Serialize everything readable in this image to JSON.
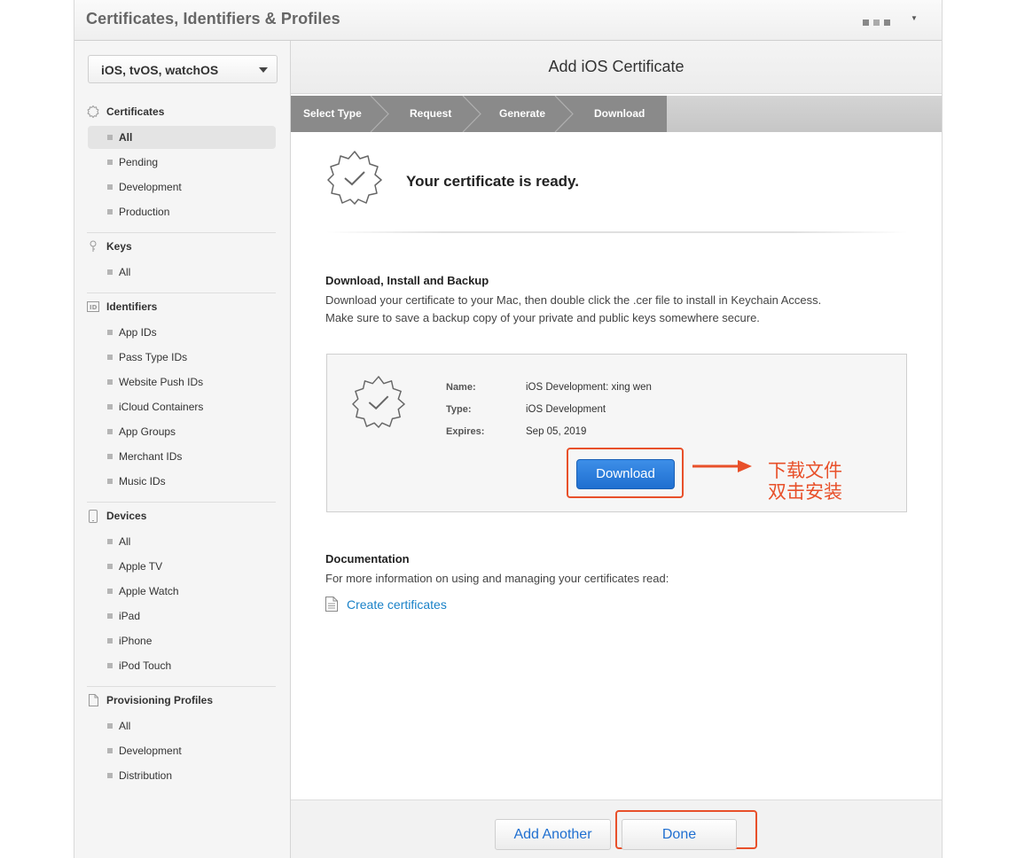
{
  "topbar": {
    "title": "Certificates, Identifiers & Profiles"
  },
  "sidebar": {
    "platform": "iOS, tvOS, watchOS",
    "sections": [
      {
        "title": "Certificates",
        "icon": "certificate-icon",
        "items": [
          "All",
          "Pending",
          "Development",
          "Production"
        ],
        "active": "All"
      },
      {
        "title": "Keys",
        "icon": "key-icon",
        "items": [
          "All"
        ]
      },
      {
        "title": "Identifiers",
        "icon": "id-icon",
        "items": [
          "App IDs",
          "Pass Type IDs",
          "Website Push IDs",
          "iCloud Containers",
          "App Groups",
          "Merchant IDs",
          "Music IDs"
        ]
      },
      {
        "title": "Devices",
        "icon": "device-icon",
        "items": [
          "All",
          "Apple TV",
          "Apple Watch",
          "iPad",
          "iPhone",
          "iPod Touch"
        ]
      },
      {
        "title": "Provisioning Profiles",
        "icon": "document-icon",
        "items": [
          "All",
          "Development",
          "Distribution"
        ]
      }
    ]
  },
  "main": {
    "title": "Add iOS Certificate",
    "steps": [
      "Select Type",
      "Request",
      "Generate",
      "Download"
    ],
    "ready": "Your certificate is ready.",
    "download_section": {
      "heading": "Download, Install and Backup",
      "line1": "Download your certificate to your Mac, then double click the .cer file to install in Keychain Access.",
      "line2": "Make sure to save a backup copy of your private and public keys somewhere secure."
    },
    "certificate": {
      "name_label": "Name:",
      "name": "iOS Development: xing wen",
      "type_label": "Type:",
      "type": "iOS Development",
      "expires_label": "Expires:",
      "expires": "Sep 05, 2019",
      "download_button": "Download"
    },
    "annotation": {
      "line1": "下载文件",
      "line2": "双击安装"
    },
    "documentation": {
      "heading": "Documentation",
      "text": "For more information on using and managing your certificates read:",
      "link": "Create certificates"
    },
    "footer": {
      "add_another": "Add Another",
      "done": "Done"
    }
  },
  "colors": {
    "accent": "#1f6fd0",
    "annotation": "#e8502a",
    "link": "#1a82c8"
  }
}
